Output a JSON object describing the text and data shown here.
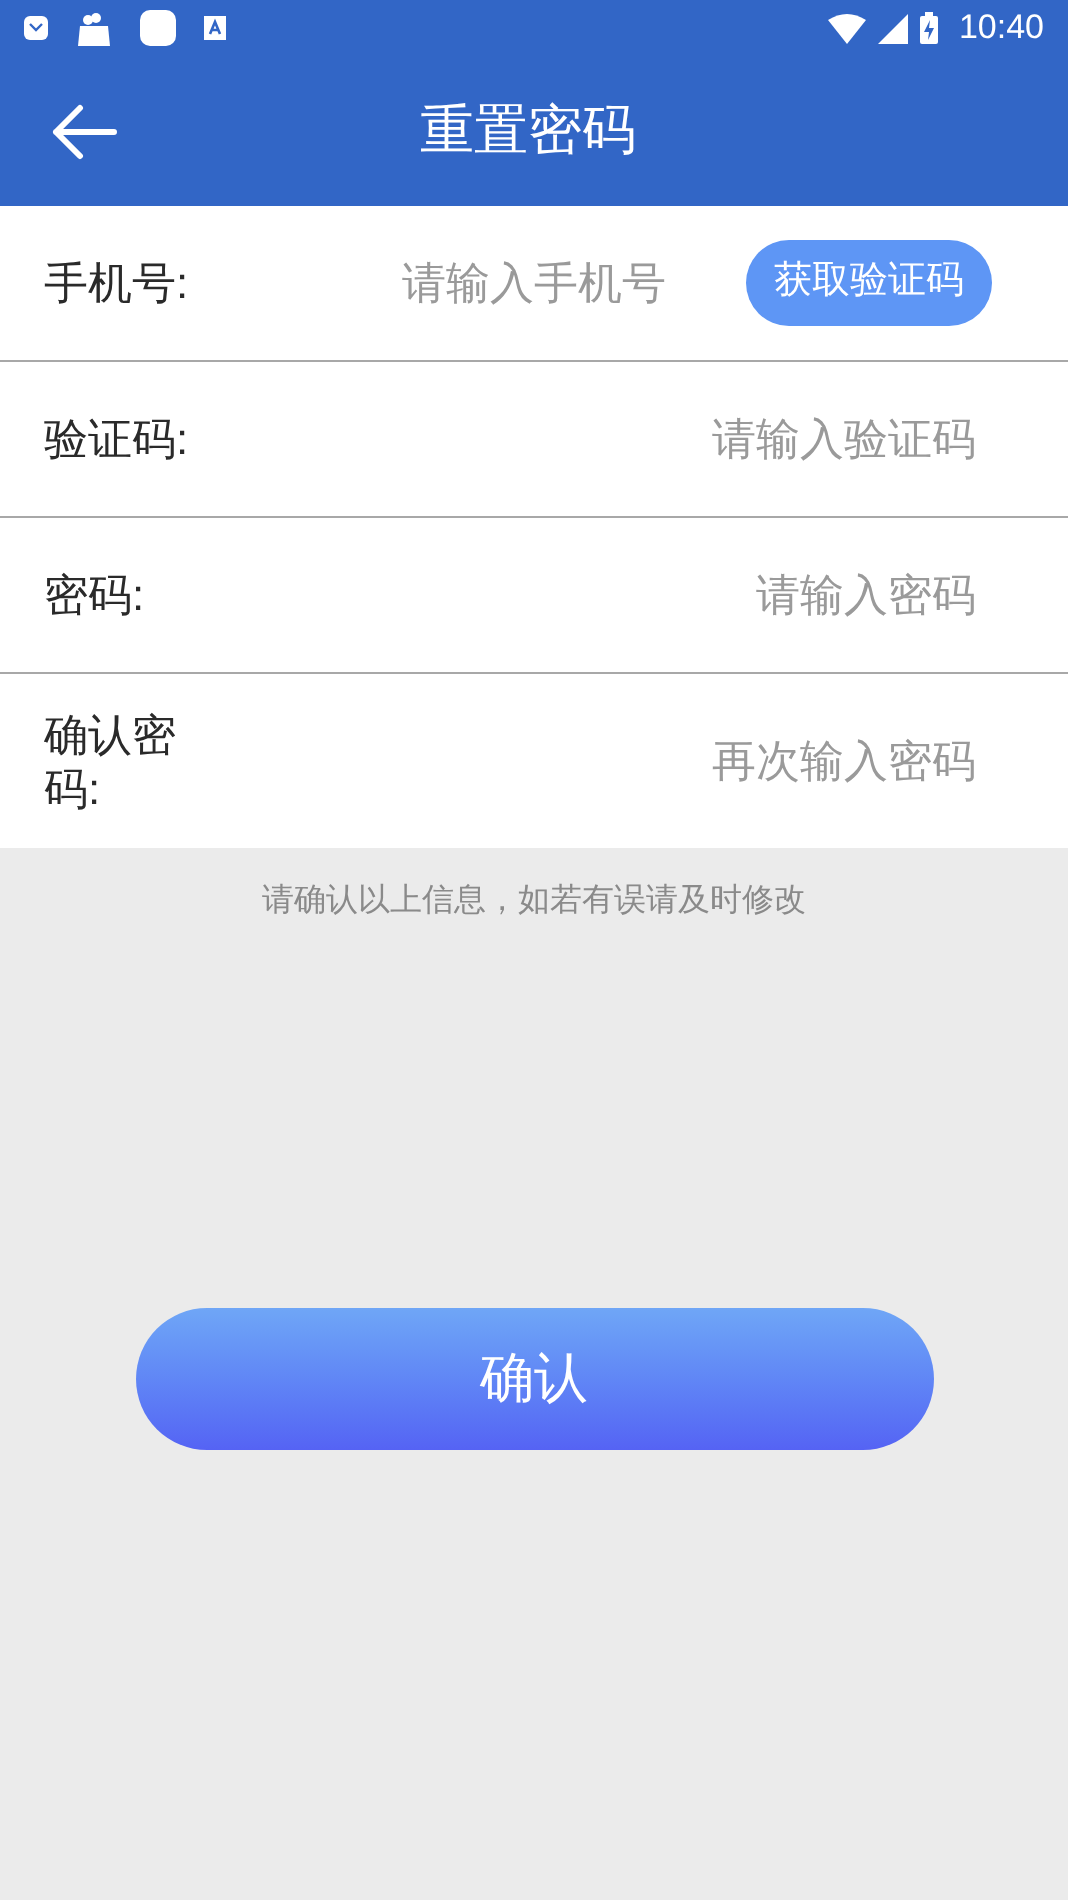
{
  "status_bar": {
    "time": "10:40"
  },
  "header": {
    "title": "重置密码"
  },
  "fields": [
    {
      "label": "手机号:",
      "placeholder": "请输入手机号",
      "button": "获取验证码"
    },
    {
      "label": "验证码:",
      "placeholder": "请输入验证码"
    },
    {
      "label": "密码:",
      "placeholder": "请输入密码"
    },
    {
      "label": "确认密码:",
      "placeholder": "再次输入密码"
    }
  ],
  "notice": "请确认以上信息，如若有误请及时修改",
  "submit": "确认"
}
